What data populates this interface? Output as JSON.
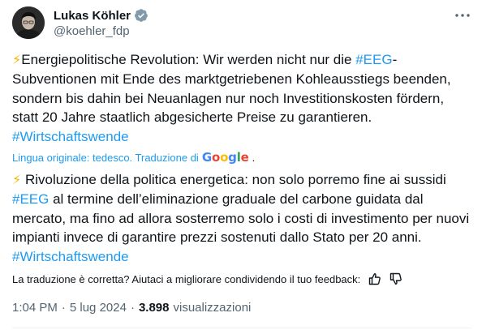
{
  "author": {
    "name": "Lukas Köhler",
    "handle": "@koehler_fdp"
  },
  "icons": {
    "verified": "verified-badge-icon",
    "more": "more-options-icon",
    "bolt": "lightning-bolt-icon",
    "thumbs_up": "thumbs-up-icon",
    "thumbs_down": "thumbs-down-icon"
  },
  "colors": {
    "link": "#1d9bf0",
    "text": "#0f1419",
    "muted": "#536471"
  },
  "tweet": {
    "original": {
      "p1": "Energiepolitische Revolution: Wir werden nicht nur die ",
      "tag1": "#EEG",
      "p2": "-Subventionen mit Ende des marktgetriebenen Kohleausstiegs beenden, sondern bis dahin bei Neuanlagen nur noch Investitionskosten fördern, statt 20 Jahre staatlich abgesicherte Preise zu garantieren. ",
      "tag2": "#Wirtschaftswende"
    },
    "translation_note": {
      "text": "Lingua originale: tedesco. Traduzione di",
      "brand": "Google",
      "suffix": "."
    },
    "translated": {
      "p1": " Rivoluzione della politica energetica: non solo porremo fine ai sussidi ",
      "tag1": "#EEG",
      "p2": " al termine dell’eliminazione graduale del carbone guidata dal mercato, ma fino ad allora sosterremo solo i costi di investimento per nuovi impianti invece di garantire prezzi sostenuti dallo Stato per 20 anni. ",
      "tag2": "#Wirtschaftswende"
    },
    "feedback_prompt": "La traduzione è corretta? Aiutaci a migliorare condividendo il tuo feedback:",
    "time": "1:04 PM",
    "sep": "·",
    "date": "5 lug 2024",
    "views_count": "3.898",
    "views_label": "visualizzazioni"
  }
}
